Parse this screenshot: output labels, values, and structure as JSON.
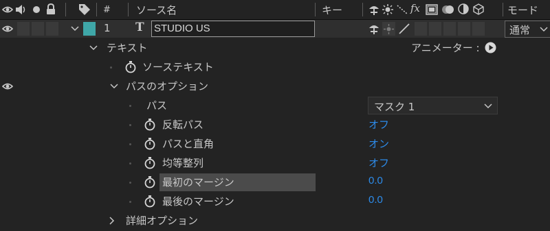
{
  "header": {
    "hash": "#",
    "source_name": "ソース名",
    "keys": "キー",
    "fx": "fx",
    "mode": "モード"
  },
  "layer": {
    "number": "1",
    "type_glyph": "T",
    "name": "STUDIO US",
    "label_color": "#3fa7a8",
    "mode_value": "通常"
  },
  "tree": {
    "text_group": "テキスト",
    "animator_label": "アニメーター :",
    "source_text": "ソーステキスト",
    "path_options": "パスのオプション",
    "path": "パス",
    "path_value": "マスク 1",
    "reverse_path": "反転パス",
    "reverse_path_value": "オフ",
    "perpendicular": "パスと直角",
    "perpendicular_value": "オン",
    "force_align": "均等整列",
    "force_align_value": "オフ",
    "first_margin": "最初のマージン",
    "first_margin_value": "0.0",
    "last_margin": "最後のマージン",
    "last_margin_value": "0.0",
    "more_options": "詳細オプション"
  },
  "colors": {
    "value_blue": "#2d8ceb",
    "label_teal": "#3fa7a8"
  }
}
